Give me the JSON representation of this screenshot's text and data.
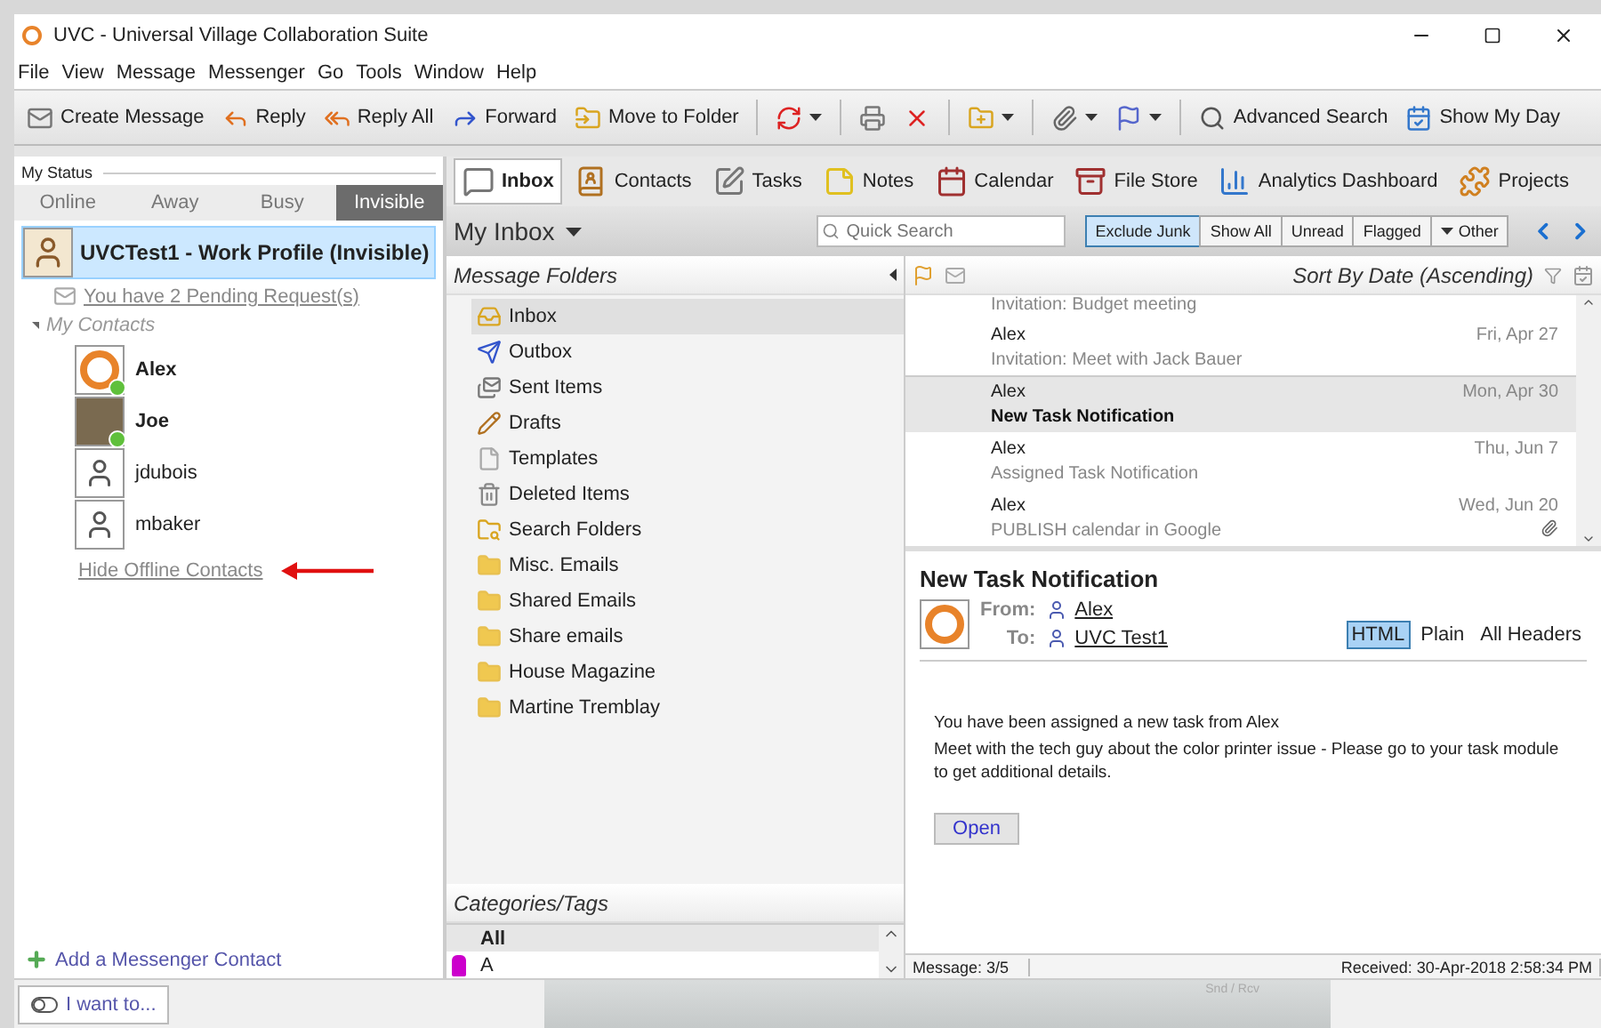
{
  "window": {
    "title": "UVC - Universal Village Collaboration Suite"
  },
  "menu": [
    "File",
    "View",
    "Message",
    "Messenger",
    "Go",
    "Tools",
    "Window",
    "Help"
  ],
  "toolbar": [
    {
      "kind": "button",
      "label": "Create Message"
    },
    {
      "kind": "button",
      "label": "Reply"
    },
    {
      "kind": "button",
      "label": "Reply All"
    },
    {
      "kind": "button",
      "label": "Forward"
    },
    {
      "kind": "button",
      "label": "Move to Folder"
    },
    {
      "kind": "separator"
    },
    {
      "kind": "dropdown"
    },
    {
      "kind": "separator"
    },
    {
      "kind": "icon"
    },
    {
      "kind": "icon"
    },
    {
      "kind": "separator"
    },
    {
      "kind": "dropdown"
    },
    {
      "kind": "separator"
    },
    {
      "kind": "dropdown"
    },
    {
      "kind": "dropdown"
    },
    {
      "kind": "separator"
    },
    {
      "kind": "button",
      "label": "Advanced Search"
    },
    {
      "kind": "button",
      "label": "Show My Day"
    }
  ],
  "status": {
    "heading": "My Status",
    "options": [
      {
        "label": "Online",
        "selected": false
      },
      {
        "label": "Away",
        "selected": false
      },
      {
        "label": "Busy",
        "selected": false
      },
      {
        "label": "Invisible",
        "selected": true
      }
    ]
  },
  "profile": {
    "name": "UVCTest1 - Work Profile (Invisible)"
  },
  "pending": "You have 2 Pending Request(s)",
  "contacts": {
    "label": "My Contacts",
    "expanded": true,
    "items": [
      {
        "name": "Alex",
        "online": true
      },
      {
        "name": "Joe",
        "online": true
      },
      {
        "name": "jdubois",
        "online": false
      },
      {
        "name": "mbaker",
        "online": false
      }
    ]
  },
  "hide_offline": "Hide Offline Contacts",
  "add_contact": "Add a Messenger Contact",
  "nav_tabs": [
    {
      "label": "Inbox",
      "selected": true
    },
    {
      "label": "Contacts",
      "selected": false
    },
    {
      "label": "Tasks",
      "selected": false
    },
    {
      "label": "Notes",
      "selected": false
    },
    {
      "label": "Calendar",
      "selected": false
    },
    {
      "label": "File Store",
      "selected": false
    },
    {
      "label": "Analytics Dashboard",
      "selected": false
    },
    {
      "label": "Projects",
      "selected": false
    }
  ],
  "inbox": {
    "title": "My Inbox",
    "search_placeholder": "Quick Search",
    "filters": [
      {
        "label": "Exclude Junk",
        "selected": true,
        "kind": "plain"
      },
      {
        "label": "Show All",
        "selected": false,
        "kind": "plain"
      },
      {
        "label": "Unread",
        "selected": false,
        "kind": "plain"
      },
      {
        "label": "Flagged",
        "selected": false,
        "kind": "plain"
      },
      {
        "label": "Other",
        "selected": false,
        "kind": "menu"
      }
    ]
  },
  "folders": {
    "title": "Message Folders",
    "items": [
      {
        "label": "Inbox",
        "selected": true
      },
      {
        "label": "Outbox",
        "selected": false
      },
      {
        "label": "Sent Items",
        "selected": false
      },
      {
        "label": "Drafts",
        "selected": false
      },
      {
        "label": "Templates",
        "selected": false
      },
      {
        "label": "Deleted Items",
        "selected": false
      },
      {
        "label": "Search Folders",
        "selected": false
      },
      {
        "label": "Misc. Emails",
        "selected": false
      },
      {
        "label": "Shared Emails",
        "selected": false
      },
      {
        "label": "Share emails",
        "selected": false
      },
      {
        "label": "House Magazine",
        "selected": false
      },
      {
        "label": "Martine Tremblay",
        "selected": false
      }
    ]
  },
  "categories": {
    "title": "Categories/Tags",
    "items": [
      {
        "label": "All",
        "selected": true
      },
      {
        "label": "A",
        "selected": false,
        "color": "#cc00cc"
      }
    ]
  },
  "sort": "Sort By Date (Ascending)",
  "messages": [
    {
      "kind": "partial",
      "subject": "Invitation: Budget meeting"
    },
    {
      "kind": "full",
      "sender": "Alex",
      "subject": "Invitation: Meet with Jack Bauer",
      "date": "Fri, Apr 27",
      "selected": false,
      "attachment": false
    },
    {
      "kind": "full",
      "sender": "Alex",
      "subject": "New Task Notification",
      "date": "Mon, Apr 30",
      "selected": true,
      "attachment": false
    },
    {
      "kind": "full",
      "sender": "Alex",
      "subject": "Assigned Task Notification",
      "date": "Thu, Jun 7",
      "selected": false,
      "attachment": false
    },
    {
      "kind": "full",
      "sender": "Alex",
      "subject": "PUBLISH calendar in Google",
      "date": "Wed, Jun 20",
      "selected": false,
      "attachment": true
    }
  ],
  "preview": {
    "title": "New Task Notification",
    "from_label": "From:",
    "from": "Alex",
    "to_label": "To:",
    "to": "UVC Test1",
    "views": [
      {
        "label": "HTML",
        "selected": true
      },
      {
        "label": "Plain",
        "selected": false
      },
      {
        "label": "All Headers",
        "selected": false
      }
    ],
    "body": [
      "You have been assigned a new task from Alex",
      "Meet with the tech guy about the color printer issue - Please go to your task module to get additional details."
    ],
    "button": "Open"
  },
  "status_bar": {
    "message": "Message: 3/5",
    "received": "Received: 30-Apr-2018 2:58:34 PM"
  },
  "bottom": {
    "i_want": "I want to...",
    "send_receive": "Snd / Rcv"
  }
}
